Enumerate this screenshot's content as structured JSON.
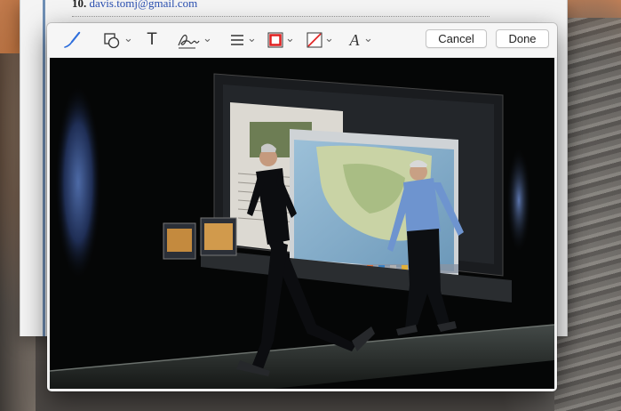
{
  "mail": {
    "line_number": "10.",
    "line_text": "davis.tomj@gmail.com"
  },
  "toolbar": {
    "tools": [
      {
        "name": "sketch-tool",
        "icon": "pen-icon",
        "active": true
      },
      {
        "name": "shapes-tool",
        "icon": "shapes-icon"
      },
      {
        "name": "text-tool",
        "icon": "text-icon",
        "glyph": "T"
      },
      {
        "name": "sign-tool",
        "icon": "signature-icon"
      },
      {
        "name": "line-style-tool",
        "icon": "line-style-icon"
      },
      {
        "name": "border-color-tool",
        "icon": "border-color-icon",
        "color": "#e02020"
      },
      {
        "name": "fill-color-tool",
        "icon": "fill-color-icon",
        "color": "#e02020"
      },
      {
        "name": "text-style-tool",
        "icon": "text-style-icon",
        "glyph": "A"
      }
    ],
    "cancel_label": "Cancel",
    "done_label": "Done",
    "accent": "#2f6fdc"
  },
  "image": {
    "subject": "keynote-stage-photo"
  }
}
